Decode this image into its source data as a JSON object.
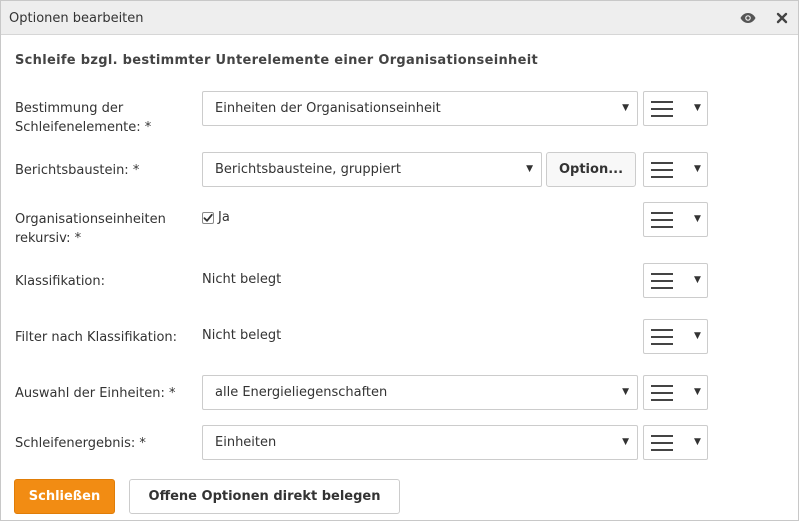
{
  "dialog": {
    "title": "Optionen bearbeiten"
  },
  "section": {
    "heading": "Schleife bzgl. bestimmter Unterelemente einer Organisationseinheit"
  },
  "fields": {
    "bestimmung": {
      "label_line1": "Bestimmung der",
      "label_line2": "Schleifenelemente: *",
      "value": "Einheiten der Organisationseinheit"
    },
    "berichtsbaustein": {
      "label": "Berichtsbaustein: *",
      "value": "Berichtsbausteine, gruppiert",
      "option_button": "Option..."
    },
    "rekursiv": {
      "label_line1": "Organisationseinheiten",
      "label_line2": "rekursiv: *",
      "checked": true,
      "checkbox_label": "Ja"
    },
    "klassifikation": {
      "label": "Klassifikation:",
      "value": "Nicht belegt"
    },
    "filter": {
      "label": "Filter nach Klassifikation:",
      "value": "Nicht belegt"
    },
    "auswahl": {
      "label": "Auswahl der Einheiten: *",
      "value": "alle Energieliegenschaften"
    },
    "ergebnis": {
      "label": "Schleifenergebnis: *",
      "value": "Einheiten"
    }
  },
  "footer": {
    "close_label": "Schließen",
    "assign_label": "Offene Optionen direkt belegen"
  },
  "colors": {
    "primary": "#f28c13",
    "titlebar_bg": "#eeeeee"
  }
}
